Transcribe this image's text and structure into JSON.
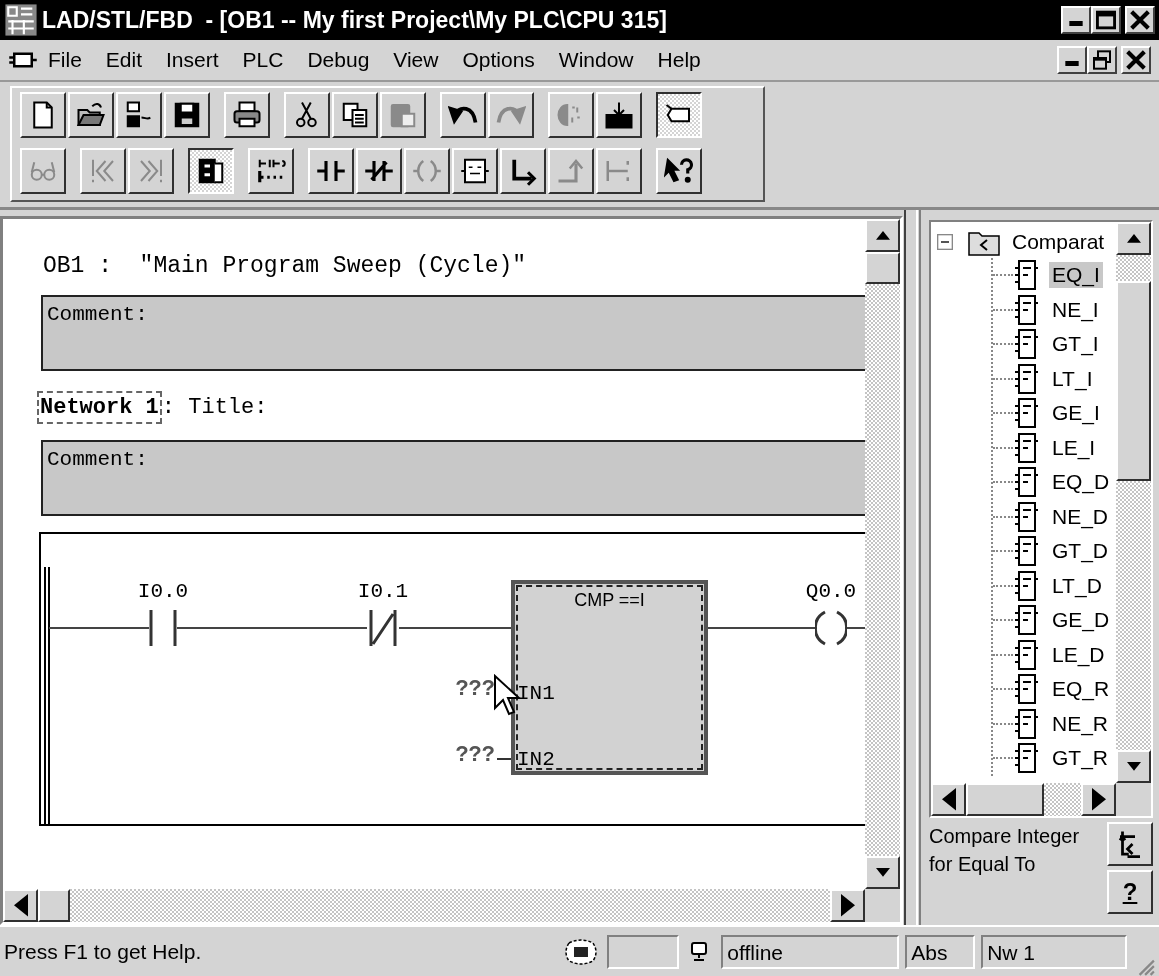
{
  "window": {
    "title": "LAD/STL/FBD  - [OB1 -- My first Project\\My PLC\\CPU 315]"
  },
  "menu": [
    "File",
    "Edit",
    "Insert",
    "PLC",
    "Debug",
    "View",
    "Options",
    "Window",
    "Help"
  ],
  "toolbar": {
    "rows": [
      [
        [
          {
            "kind": "new",
            "disabled": false,
            "pressed": false
          },
          {
            "kind": "open",
            "disabled": false,
            "pressed": false
          },
          {
            "kind": "nodes",
            "disabled": false,
            "pressed": false
          },
          {
            "kind": "save",
            "disabled": false,
            "pressed": false
          }
        ],
        [
          {
            "kind": "print",
            "disabled": false,
            "pressed": false
          }
        ],
        [
          {
            "kind": "cut",
            "disabled": false,
            "pressed": false
          },
          {
            "kind": "copy",
            "disabled": false,
            "pressed": false
          },
          {
            "kind": "paste",
            "disabled": true,
            "pressed": false
          }
        ],
        [
          {
            "kind": "undo",
            "disabled": false,
            "pressed": false
          },
          {
            "kind": "redo",
            "disabled": true,
            "pressed": false
          }
        ],
        [
          {
            "kind": "monitor",
            "disabled": true,
            "pressed": false
          },
          {
            "kind": "download",
            "disabled": false,
            "pressed": false
          }
        ],
        [
          {
            "kind": "catalog",
            "disabled": false,
            "pressed": true
          }
        ]
      ],
      [
        [
          {
            "kind": "glasses",
            "disabled": true,
            "pressed": false
          }
        ],
        [
          {
            "kind": "first",
            "disabled": true,
            "pressed": false
          },
          {
            "kind": "last",
            "disabled": true,
            "pressed": false
          }
        ],
        [
          {
            "kind": "overview",
            "disabled": false,
            "pressed": true
          }
        ],
        [
          {
            "kind": "network",
            "disabled": false,
            "pressed": false
          }
        ],
        [
          {
            "kind": "no_contact",
            "disabled": false,
            "pressed": false
          },
          {
            "kind": "nc_contact",
            "disabled": false,
            "pressed": false
          },
          {
            "kind": "coil",
            "disabled": true,
            "pressed": false
          },
          {
            "kind": "box",
            "disabled": false,
            "pressed": false
          },
          {
            "kind": "branch",
            "disabled": false,
            "pressed": false
          },
          {
            "kind": "close_branch",
            "disabled": true,
            "pressed": false
          },
          {
            "kind": "connection",
            "disabled": true,
            "pressed": false
          }
        ],
        [
          {
            "kind": "help_pointer",
            "disabled": false,
            "pressed": false
          }
        ]
      ]
    ]
  },
  "editor": {
    "block_title": "OB1 :  \"Main Program Sweep (Cycle)\"",
    "block_comment": "Comment:",
    "network": {
      "label": "Network 1",
      "selected": true,
      "title": ": Title:",
      "comment": "Comment:",
      "elements": [
        {
          "kind": "no_contact",
          "address": "I0.0"
        },
        {
          "kind": "nc_contact",
          "address": "I0.1"
        },
        {
          "kind": "compare_box",
          "title": "CMP ==I",
          "inputs": [
            {
              "pin": "IN1",
              "operand": "???"
            },
            {
              "pin": "IN2",
              "operand": "???"
            }
          ]
        },
        {
          "kind": "coil",
          "address": "Q0.0"
        }
      ]
    }
  },
  "library": {
    "root": {
      "label": "Comparat",
      "expanded": true,
      "children": [
        {
          "label": "EQ_I",
          "selected": true
        },
        {
          "label": "NE_I",
          "selected": false
        },
        {
          "label": "GT_I",
          "selected": false
        },
        {
          "label": "LT_I",
          "selected": false
        },
        {
          "label": "GE_I",
          "selected": false
        },
        {
          "label": "LE_I",
          "selected": false
        },
        {
          "label": "EQ_D",
          "selected": false
        },
        {
          "label": "NE_D",
          "selected": false
        },
        {
          "label": "GT_D",
          "selected": false
        },
        {
          "label": "LT_D",
          "selected": false
        },
        {
          "label": "GE_D",
          "selected": false
        },
        {
          "label": "LE_D",
          "selected": false
        },
        {
          "label": "EQ_R",
          "selected": false
        },
        {
          "label": "NE_R",
          "selected": false
        },
        {
          "label": "GT_R",
          "selected": false
        }
      ]
    },
    "description": "Compare Integer for Equal To",
    "help_button": "?"
  },
  "status_bar": {
    "message": "Press F1 to get Help.",
    "connection": "offline",
    "mode": "Abs",
    "network": "Nw 1"
  }
}
